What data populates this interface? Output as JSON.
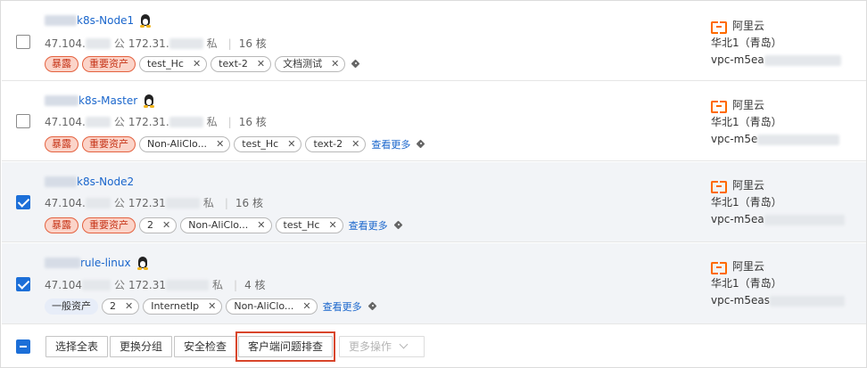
{
  "rows": [
    {
      "name_suffix": "k8s-Node1",
      "ip_public_prefix": "47.104.",
      "public_label": "公",
      "ip_private_prefix": "172.31.",
      "private_label": "私",
      "cores": "16 核",
      "red_tags": [
        "暴露",
        "重要资产"
      ],
      "plain_tags": [
        "test_Hc",
        "text-2",
        "文档测试"
      ],
      "more": "",
      "region": "华北1（青岛）",
      "vpc_prefix": "vpc-m5ea",
      "checked": false
    },
    {
      "name_suffix": "k8s-Master",
      "ip_public_prefix": "47.104.",
      "public_label": "公",
      "ip_private_prefix": "172.31.",
      "private_label": "私",
      "cores": "16 核",
      "red_tags": [
        "暴露",
        "重要资产"
      ],
      "plain_tags": [
        "Non-AliClo...",
        "test_Hc",
        "text-2"
      ],
      "more": "查看更多",
      "region": "华北1（青岛）",
      "vpc_prefix": "vpc-m5e",
      "checked": false
    },
    {
      "name_suffix": "k8s-Node2",
      "ip_public_prefix": "47.104.",
      "public_label": "公",
      "ip_private_prefix": "172.31",
      "private_label": "私",
      "cores": "16 核",
      "red_tags": [
        "暴露",
        "重要资产"
      ],
      "plain_tags": [
        "2",
        "Non-AliClo...",
        "test_Hc"
      ],
      "more": "查看更多",
      "region": "华北1（青岛）",
      "vpc_prefix": "vpc-m5ea",
      "checked": true
    },
    {
      "name_suffix": "rule-linux",
      "ip_public_prefix": "47.104",
      "public_label": "公",
      "ip_private_prefix": "172.31",
      "private_label": "私",
      "cores": "4 核",
      "blue_tags": [
        "一般资产"
      ],
      "plain_tags": [
        "2",
        "InternetIp",
        "Non-AliClo..."
      ],
      "more": "查看更多",
      "region": "华北1（青岛）",
      "vpc_prefix": "vpc-m5eas",
      "checked": true
    }
  ],
  "provider": "阿里云",
  "close_glyph": "✕",
  "footer": {
    "select_all": "选择全表",
    "change_group": "更换分组",
    "security_check": "安全检查",
    "client_troubleshoot": "客户端问题排查",
    "more_actions": "更多操作"
  },
  "colors": {
    "accent": "#1c6fd8",
    "link": "#1a66cc",
    "danger": "#e4613f",
    "highlight": "#d8452b",
    "aliyun": "#ff6a00"
  },
  "icons": {
    "os": "linux-penguin-icon",
    "tag": "tag-icon",
    "provider": "aliyun-logo-icon"
  }
}
